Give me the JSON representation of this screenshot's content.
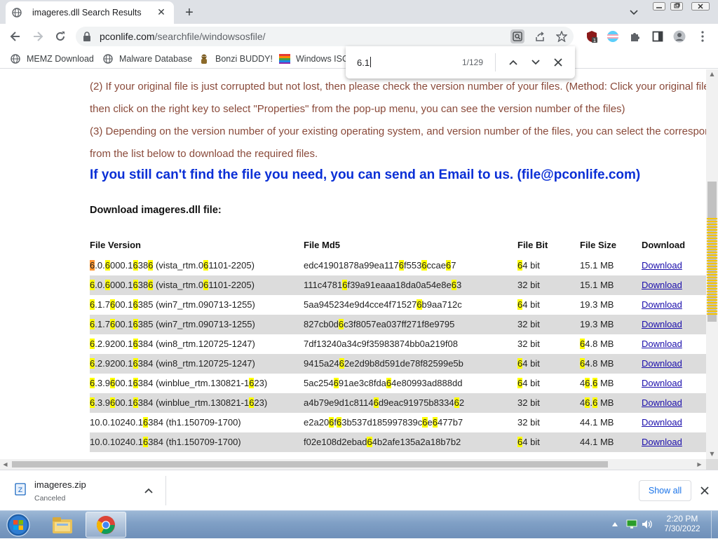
{
  "tab": {
    "title": "imageres.dll Search Results",
    "close": "✕"
  },
  "new_tab": "+",
  "url": {
    "host": "pconlife.com",
    "path": "/searchfile/windowsosfile/"
  },
  "bookmarks": [
    {
      "label": "MEMZ Download",
      "icon": "globe-icon"
    },
    {
      "label": "Malware Database",
      "icon": "globe-icon"
    },
    {
      "label": "Bonzi BUDDY!",
      "icon": "bonzi-icon"
    },
    {
      "label": "Windows ISO",
      "icon": "windows-flag-icon"
    }
  ],
  "find": {
    "query": "6.1",
    "count": "1/129"
  },
  "page": {
    "para_lines": [
      " (2) If your original file is just corrupted but not lost, then please check the version number of your files. (Method: Click your original file,",
      "then click on the right key to select \"Properties\" from the pop-up menu, you can see the version number of the files)",
      " (3) Depending on the version number of your existing operating system, and version number of the files, you can select the corresponding files",
      "from the list below to download the required files."
    ],
    "email_line": "If you still can't find the file you need, you can send an Email to us. (file@pconlife.com)",
    "download_heading": "Download imageres.dll file:",
    "table_headers": [
      "File Version",
      "File Md5",
      "File Bit",
      "File Size",
      "Download"
    ],
    "rows": [
      {
        "version": "6.0.6000.16386 (vista_rtm.061101-2205)",
        "md5": "edc41901878a99ea1176f5536ccae67",
        "bit": "64 bit",
        "size": "15.1 MB",
        "link": "Download"
      },
      {
        "version": "6.0.6000.16386 (vista_rtm.061101-2205)",
        "md5": "111c47816f39a91eaaa18da0a54e8e63",
        "bit": "32 bit",
        "size": "15.1 MB",
        "link": "Download"
      },
      {
        "version": "6.1.7600.16385 (win7_rtm.090713-1255)",
        "md5": "5aa945234e9d4cce4f715276b9aa712c",
        "bit": "64 bit",
        "size": "19.3 MB",
        "link": "Download"
      },
      {
        "version": "6.1.7600.16385 (win7_rtm.090713-1255)",
        "md5": "827cb0d6c3f8057ea037ff271f8e9795",
        "bit": "32 bit",
        "size": "19.3 MB",
        "link": "Download"
      },
      {
        "version": "6.2.9200.16384 (win8_rtm.120725-1247)",
        "md5": "7df13240a34c9f35983874bb0a219f08",
        "bit": "32 bit",
        "size": "64.8 MB",
        "link": "Download"
      },
      {
        "version": "6.2.9200.16384 (win8_rtm.120725-1247)",
        "md5": "9415a2462e2d9b8d591de78f82599e5b",
        "bit": "64 bit",
        "size": "64.8 MB",
        "link": "Download"
      },
      {
        "version": "6.3.9600.16384 (winblue_rtm.130821-1623)",
        "md5": "5ac254691ae3c8fda64e80993ad888dd",
        "bit": "64 bit",
        "size": "46.6 MB",
        "link": "Download"
      },
      {
        "version": "6.3.9600.16384 (winblue_rtm.130821-1623)",
        "md5": "a4b79e9d1c81146d9eac91975b833462",
        "bit": "32 bit",
        "size": "46.6 MB",
        "link": "Download"
      },
      {
        "version": "10.0.10240.16384 (th1.150709-1700)",
        "md5": "e2a206f63b537d185997839c6e6477b7",
        "bit": "32 bit",
        "size": "44.1 MB",
        "link": "Download"
      },
      {
        "version": "10.0.10240.16384 (th1.150709-1700)",
        "md5": "f02e108d2ebad64b2afe135a2a18b7b2",
        "bit": "64 bit",
        "size": "44.1 MB",
        "link": "Download"
      }
    ]
  },
  "download_item": {
    "name": "imageres.zip",
    "status": "Canceled"
  },
  "show_all": "Show all",
  "clock": {
    "time": "2:20 PM",
    "date": "7/30/2022"
  },
  "colors": {
    "find_highlight": "#ffff00",
    "active_match": "#ff9632",
    "email_blue": "#0a2fd6",
    "para_brown": "#8a4a3a",
    "row_alt": "#dcdcdc",
    "link": "#1a0dab"
  }
}
